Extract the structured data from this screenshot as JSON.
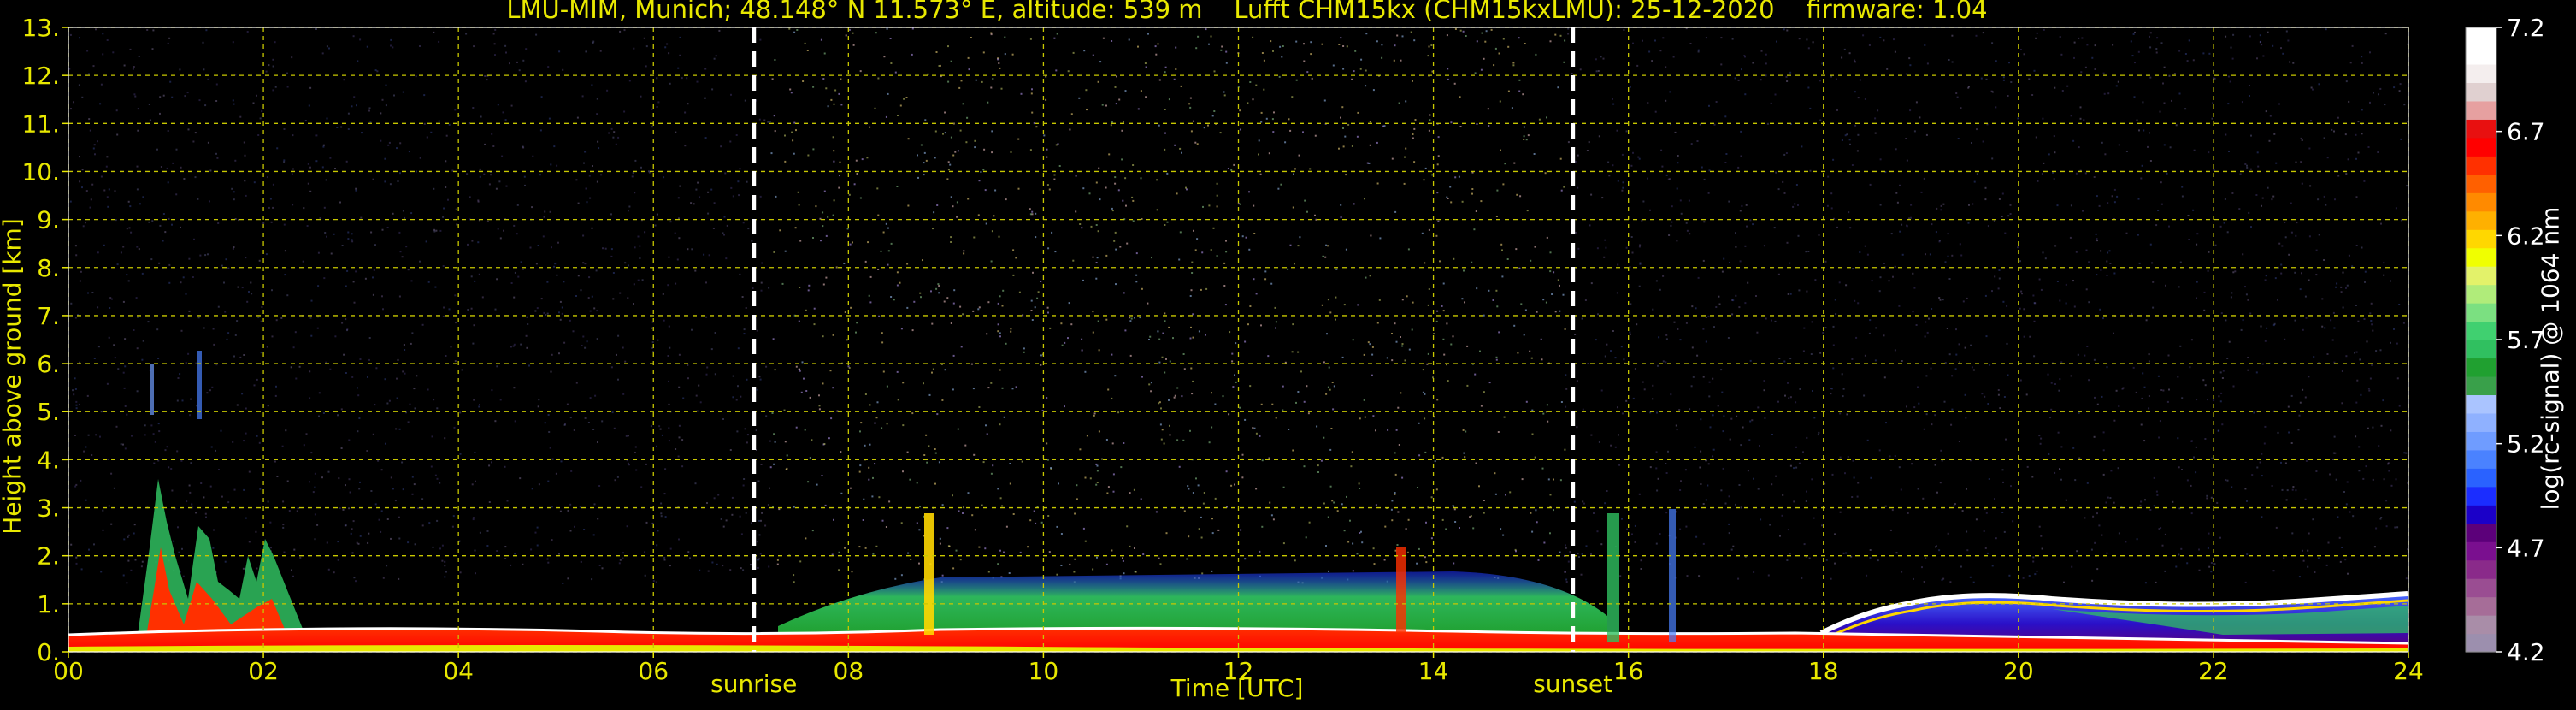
{
  "header": {
    "title": "LMU-MIM, Munich; 48.148° N 11.573° E, altitude: 539 m    Lufft CHM15kx (CHM15kxLMU): 25-12-2020    firmware: 1.04"
  },
  "colors": {
    "background": "#000000",
    "axis_text": "#e8e800",
    "gridlines": "#c8c800",
    "event_lines": "#ffffff",
    "colorbar_text": "#ffffff"
  },
  "chart_data": {
    "type": "heatmap",
    "title": "LMU-MIM, Munich; 48.148° N 11.573° E, altitude: 539 m    Lufft CHM15kx (CHM15kxLMU): 25-12-2020    firmware: 1.04",
    "xlabel": "Time [UTC]",
    "ylabel": "Height above ground [km]",
    "xlim": [
      0,
      24
    ],
    "ylim": [
      0,
      13
    ],
    "x_ticks": [
      "00",
      "02",
      "04",
      "06",
      "08",
      "10",
      "12",
      "14",
      "16",
      "18",
      "20",
      "22",
      "24"
    ],
    "y_ticks": [
      "0.",
      "1.",
      "2.",
      "3.",
      "4.",
      "5.",
      "6.",
      "7.",
      "8.",
      "9.",
      "10.",
      "11.",
      "12.",
      "13."
    ],
    "grid": true,
    "events": [
      {
        "label": "sunrise",
        "time": 7.03
      },
      {
        "label": "sunset",
        "time": 15.43
      }
    ],
    "colorbar": {
      "label": "log(rc-signal) @ 1064 nm",
      "range": [
        4.2,
        7.2
      ],
      "ticks": [
        "4.2",
        "4.7",
        "5.2",
        "5.7",
        "6.2",
        "6.7",
        "7.2"
      ],
      "colors": [
        "#9c8fae",
        "#a98da8",
        "#a66d98",
        "#9a4d92",
        "#8a2a8a",
        "#7a0f8f",
        "#5c007a",
        "#1b00c8",
        "#1b2dff",
        "#2a62ff",
        "#4a82ff",
        "#6f9cff",
        "#8fb1ff",
        "#aac4ff",
        "#39a04a",
        "#20a030",
        "#30c060",
        "#40d070",
        "#7be081",
        "#b0ec7a",
        "#e3f26a",
        "#f0ff00",
        "#ffd700",
        "#ffb000",
        "#ff8a00",
        "#ff6000",
        "#ff3000",
        "#ff0000",
        "#e81010",
        "#e6a0a0",
        "#e0d0d0",
        "#f4eeee",
        "#ffffff",
        "#ffffff"
      ]
    },
    "features": [
      {
        "description": "night-time low clouds and aerosol plumes",
        "x_range": [
          0.7,
          2.5
        ],
        "height_range": [
          0,
          4.0
        ]
      },
      {
        "description": "daytime boundary layer",
        "x_range": [
          7.4,
          15.1
        ],
        "height_range": [
          0.6,
          1.7
        ]
      },
      {
        "description": "stratiform cloud deck with top near 1.2 km",
        "x_range": [
          18.0,
          24.0
        ],
        "height_range": [
          0,
          1.2
        ]
      }
    ]
  }
}
